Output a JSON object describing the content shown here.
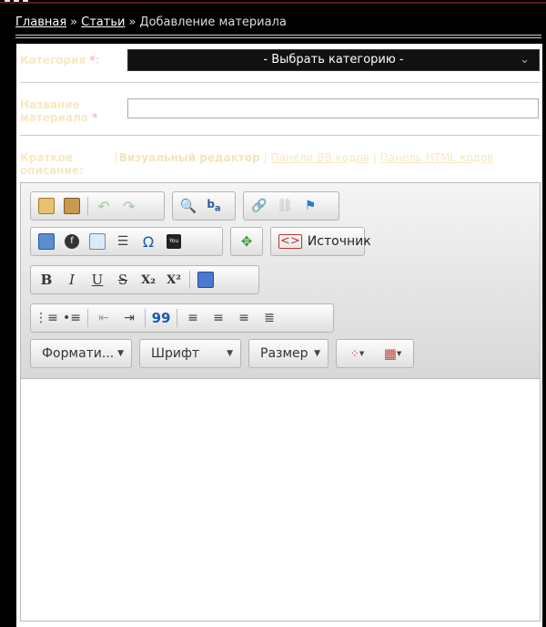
{
  "breadcrumb": {
    "home": "Главная",
    "articles": "Статьи",
    "current": "Добавление материала",
    "sep": "»"
  },
  "form": {
    "category_label": "Категория",
    "required_mark": "*",
    "category_select": "- Выбрать категорию -",
    "title_label_line1": "Название",
    "title_label_line2": "материала",
    "short_desc_line1": "Краткое",
    "short_desc_line2": "описание:"
  },
  "editor_modes": {
    "bracket": "[",
    "visual": "Визуальный редактор",
    "sep": "|",
    "bb": "Панели BB кодов",
    "html": "Панель HTML кодов"
  },
  "toolbar": {
    "source_label": "Источник",
    "format_label": "Формати...",
    "font_label": "Шрифт",
    "size_label": "Размер",
    "bold": "B",
    "italic": "I",
    "underline": "U",
    "strike": "S",
    "subscript": "X₂",
    "superscript": "X²",
    "omega": "Ω",
    "quote": "99"
  },
  "colors": {
    "accent_link": "#f6e9c4",
    "required": "#ffb8b8"
  }
}
